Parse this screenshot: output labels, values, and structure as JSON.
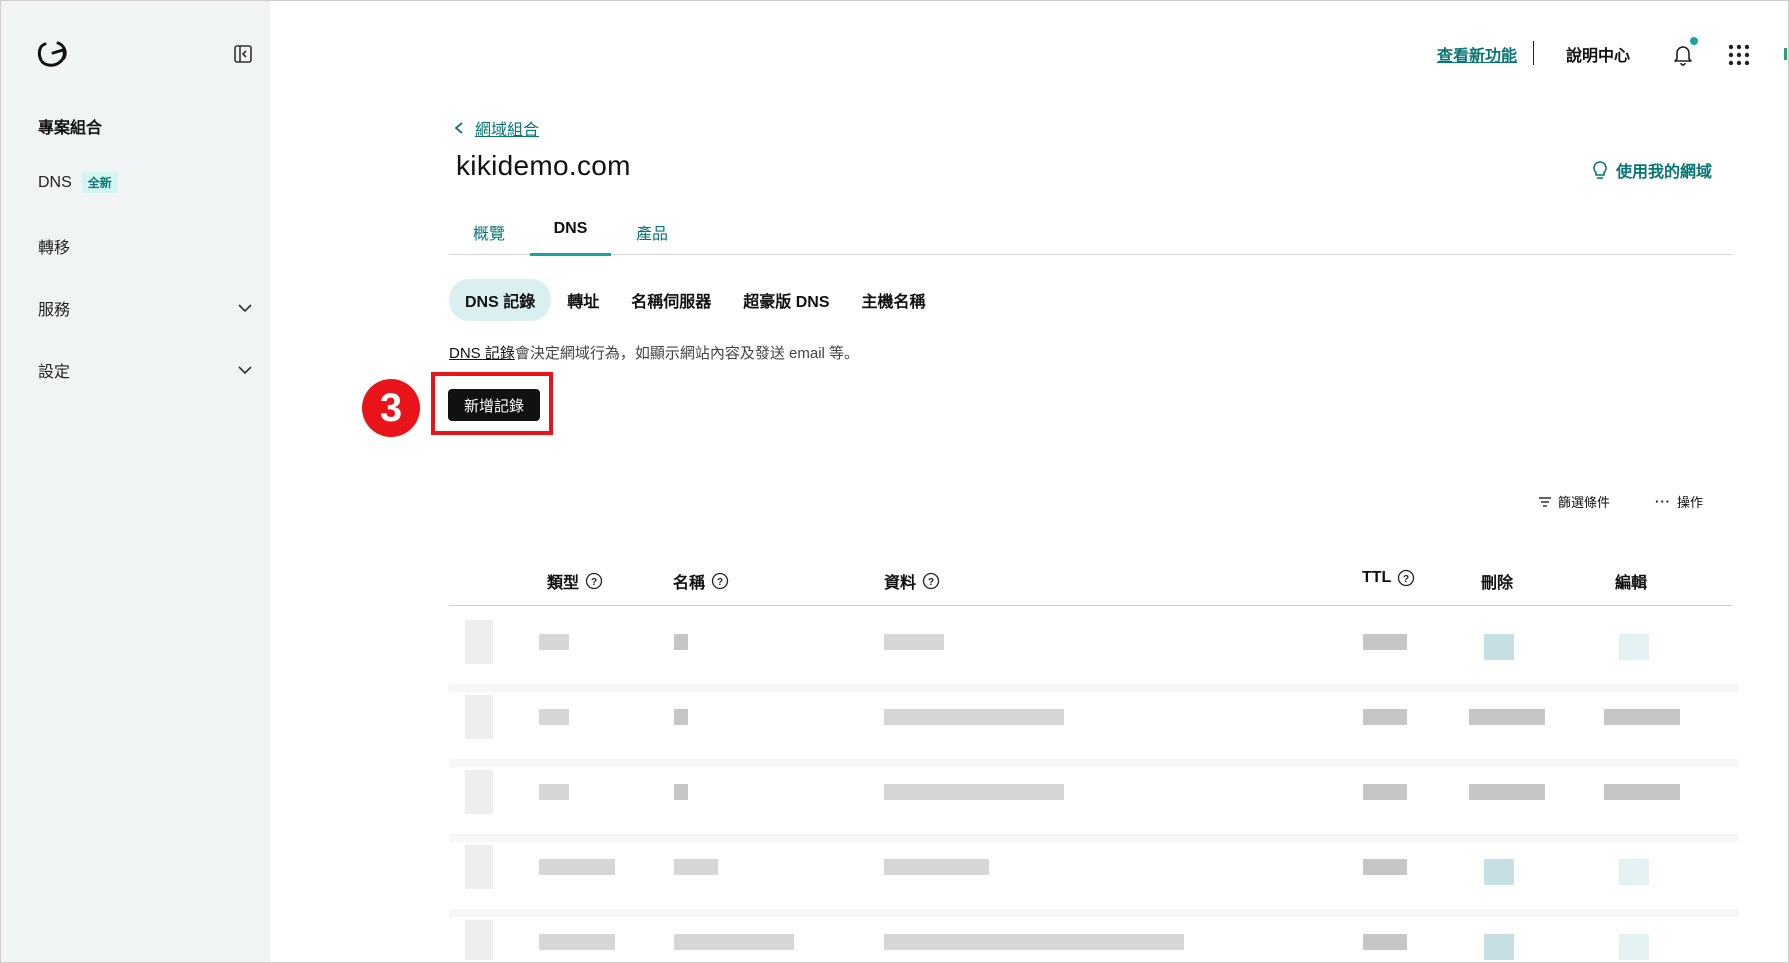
{
  "sidebar": {
    "section_title": "專案組合",
    "items": [
      {
        "label": "DNS",
        "badge": "全新"
      },
      {
        "label": "轉移"
      },
      {
        "label": "服務"
      },
      {
        "label": "設定"
      }
    ]
  },
  "topbar": {
    "whats_new": "查看新功能",
    "help_center": "說明中心",
    "icons": [
      "bell-icon",
      "apps-grid-icon"
    ]
  },
  "breadcrumb": {
    "back_label": "網域組合"
  },
  "domain": {
    "name": "kikidemo.com",
    "use_domain_label": "使用我的網域"
  },
  "tabs": [
    {
      "label": "概覽"
    },
    {
      "label": "DNS",
      "active": true
    },
    {
      "label": "產品"
    }
  ],
  "subtabs": [
    {
      "label": "DNS 記錄",
      "active": true
    },
    {
      "label": "轉址"
    },
    {
      "label": "名稱伺服器"
    },
    {
      "label": "超豪版 DNS"
    },
    {
      "label": "主機名稱"
    }
  ],
  "description": {
    "link": "DNS 記錄",
    "text": "會決定網域行為，如顯示網站內容及發送 email 等。"
  },
  "add_record_label": "新增記錄",
  "step_number": "3",
  "tools": {
    "filter_label": "篩選條件",
    "actions_label": "操作"
  },
  "table": {
    "headers": {
      "type": "類型",
      "name": "名稱",
      "data": "資料",
      "ttl": "TTL",
      "delete": "刪除",
      "edit": "編輯"
    },
    "row_count_visible": 5
  },
  "colors": {
    "accent": "#0a7575",
    "tab_underline": "#16a39a",
    "highlight": "#e8141a"
  }
}
